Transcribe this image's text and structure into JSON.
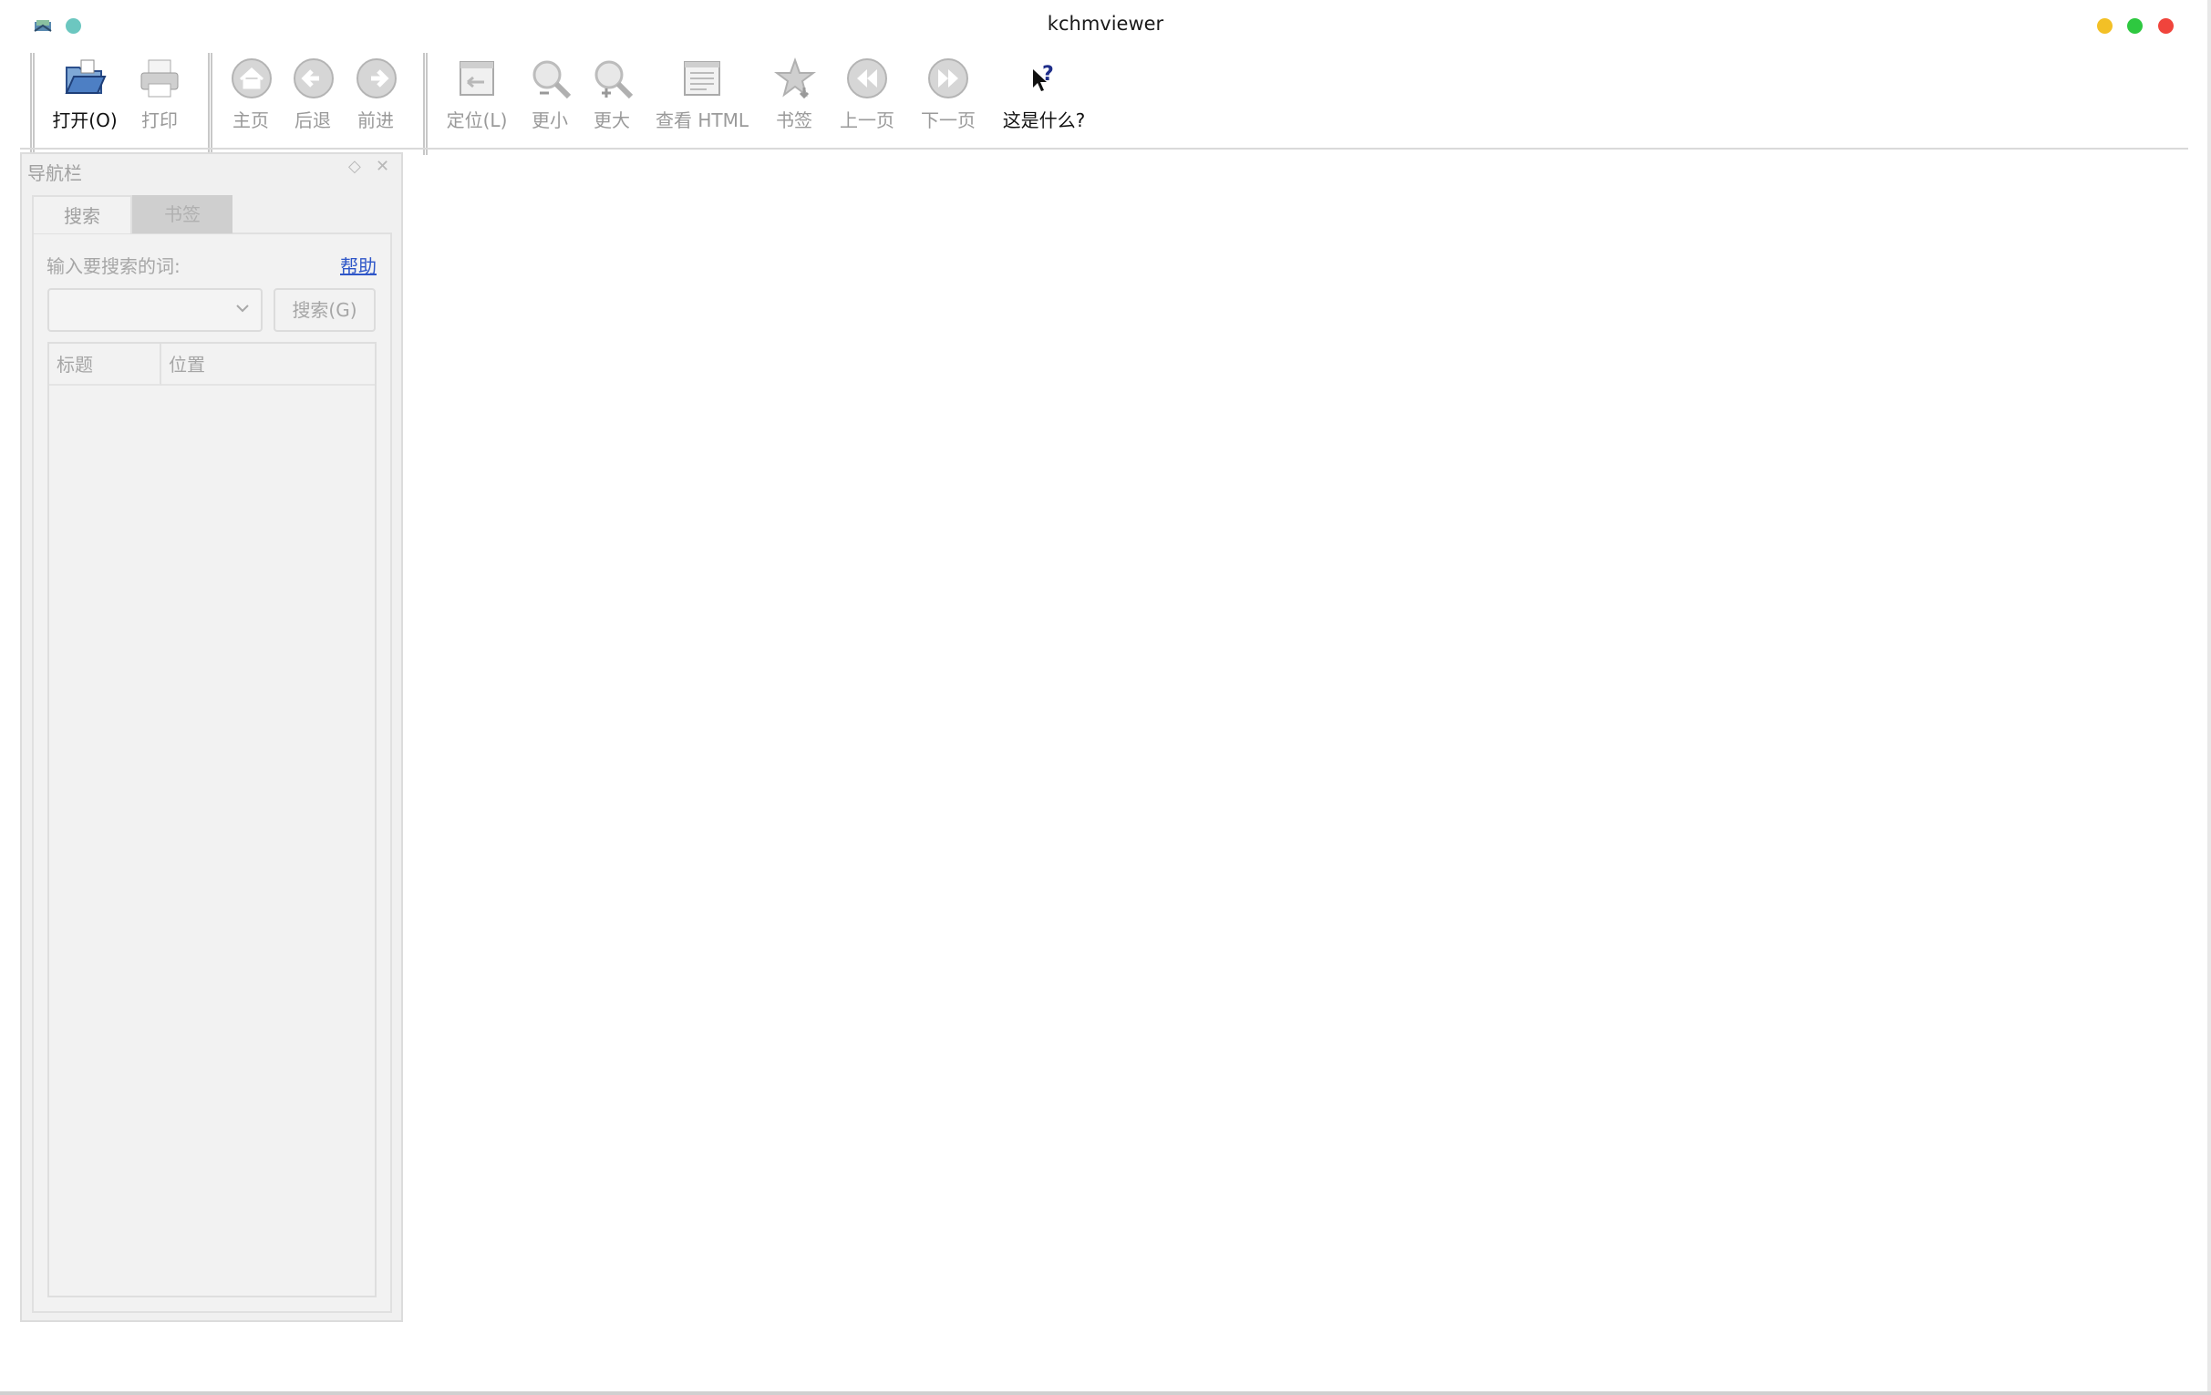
{
  "window": {
    "title": "kchmviewer",
    "controls": {
      "minimize_color": "#f3c026",
      "maximize_color": "#2ec840",
      "close_color": "#f0443c"
    }
  },
  "toolbar": {
    "open_label": "打开(O)",
    "print_label": "打印",
    "home_label": "主页",
    "back_label": "后退",
    "forward_label": "前进",
    "locate_label": "定位(L)",
    "zoom_out_label": "更小",
    "zoom_in_label": "更大",
    "view_html_label": "查看 HTML",
    "bookmark_label": "书签",
    "prev_page_label": "上一页",
    "next_page_label": "下一页",
    "whats_this_label": "这是什么?"
  },
  "nav_panel": {
    "title": "导航栏",
    "tabs": [
      {
        "label": "搜索"
      },
      {
        "label": "书签"
      }
    ],
    "search": {
      "prompt_label": "输入要搜索的词:",
      "help_link": "帮助",
      "query_value": "",
      "search_button": "搜索(G)",
      "columns": [
        "标题",
        "位置"
      ]
    }
  }
}
